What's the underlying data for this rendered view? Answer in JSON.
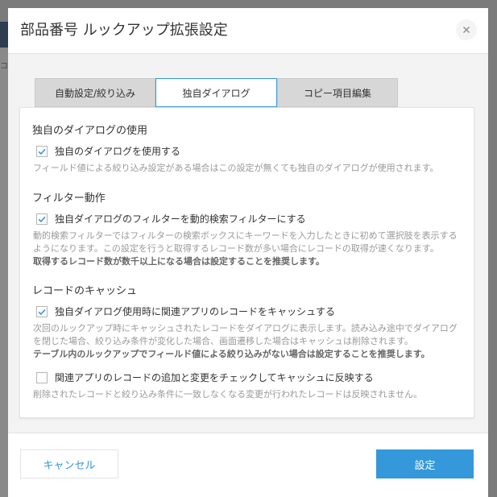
{
  "dialog": {
    "title": "部品番号 ルックアップ拡張設定"
  },
  "background": {
    "sliver_char": "コ"
  },
  "tabs": [
    {
      "label": "自動設定/絞り込み",
      "active": false
    },
    {
      "label": "独自ダイアログ",
      "active": true
    },
    {
      "label": "コピー項目編集",
      "active": false
    }
  ],
  "sections": [
    {
      "title": "独自のダイアログの使用",
      "options": [
        {
          "label": "独自のダイアログを使用する",
          "checked": true,
          "description": "フィールド値による絞り込み設定がある場合はこの設定が無くても独自のダイアログが使用されます。",
          "description_strong": ""
        }
      ]
    },
    {
      "title": "フィルター動作",
      "options": [
        {
          "label": "独自ダイアログのフィルターを動的検索フィルターにする",
          "checked": true,
          "description": "動的検索フィルターではフィルターの検索ボックスにキーワードを入力したときに初めて選択肢を表示するようになります。この設定を行うと取得するレコード数が多い場合にレコードの取得が速くなります。",
          "description_strong": "取得するレコード数が数千以上になる場合は設定することを推奨します。"
        }
      ]
    },
    {
      "title": "レコードのキャッシュ",
      "options": [
        {
          "label": "独自ダイアログ使用時に関連アプリのレコードをキャッシュする",
          "checked": true,
          "description": "次回のルックアップ時にキャッシュされたレコードをダイアログに表示します。読み込み途中でダイアログを閉じた場合、絞り込み条件が変化した場合、画面遷移した場合はキャッシュは削除されます。",
          "description_strong": "テーブル内のルックアップでフィールド値による絞り込みがない場合は設定することを推奨します。"
        },
        {
          "label": "関連アプリのレコードの追加と変更をチェックしてキャッシュに反映する",
          "checked": false,
          "description": "削除されたレコードと絞り込み条件に一致しなくなる変更が行われたレコードは反映されません。",
          "description_strong": ""
        }
      ]
    }
  ],
  "footer": {
    "cancel_label": "キャンセル",
    "ok_label": "設定"
  },
  "colors": {
    "accent": "#3498db",
    "overlay": "#7b7b7b",
    "muted_text": "#999999"
  },
  "icons": {
    "close": "close-icon",
    "check": "check-icon"
  }
}
